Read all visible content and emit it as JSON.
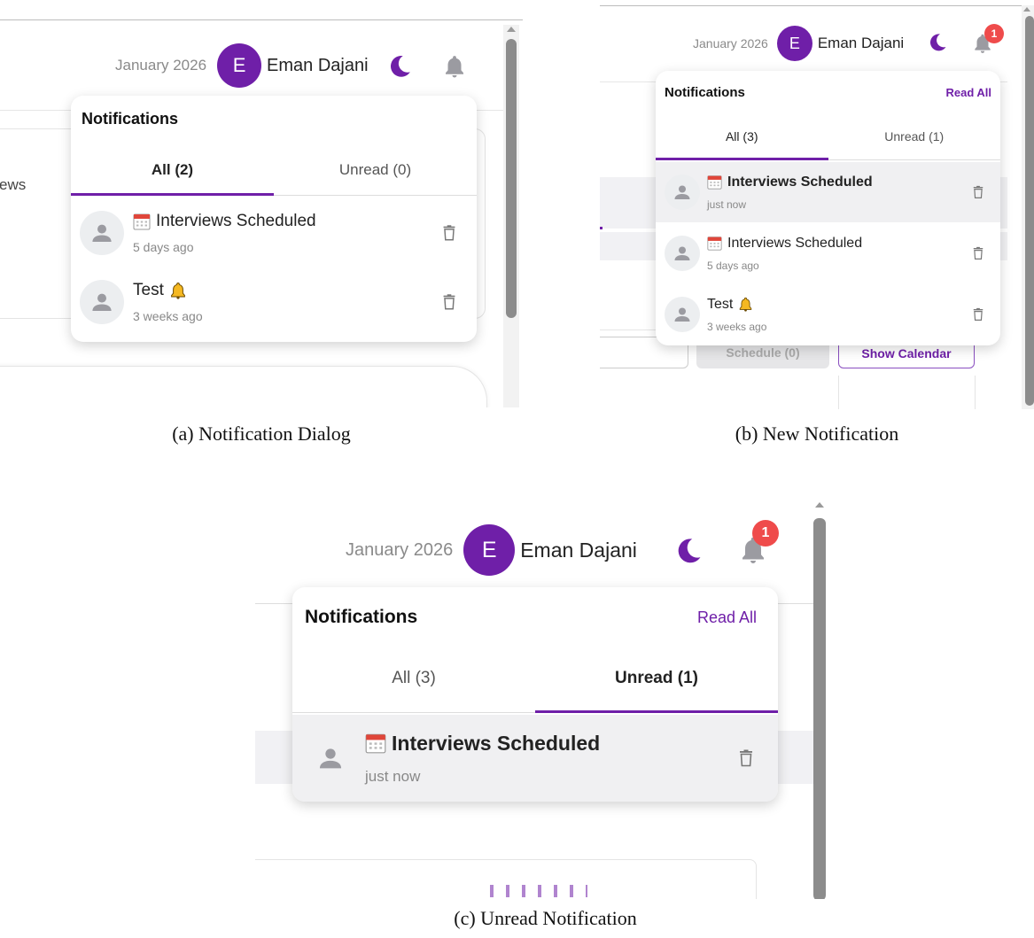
{
  "header": {
    "date": "January 2026",
    "avatar_initial": "E",
    "user_name": "Eman Dajani"
  },
  "colors": {
    "accent": "#6f1fa8",
    "badge": "#ef4b4b",
    "unread_row": "#f0f0f2"
  },
  "icons": {
    "theme": "moon-icon",
    "bell": "bell-icon",
    "person": "person-icon",
    "calendar": "calendar-emoji-icon",
    "bell_emoji": "bell-emoji-icon",
    "delete": "trash-icon"
  },
  "panel_a": {
    "caption": "(a) Notification Dialog",
    "background_text": "ews",
    "notifications": {
      "title": "Notifications",
      "tabs": [
        {
          "label": "All (2)",
          "active": true
        },
        {
          "label": "Unread (0)",
          "active": false
        }
      ],
      "items": [
        {
          "title": "Interviews Scheduled",
          "time": "5 days ago",
          "icon": "calendar",
          "unread": false
        },
        {
          "title": "Test",
          "time": "3 weeks ago",
          "icon": "bell",
          "unread": false
        }
      ]
    }
  },
  "panel_b": {
    "caption": "(b) New Notification",
    "badge_count": "1",
    "notifications": {
      "title": "Notifications",
      "read_all": "Read All",
      "tabs": [
        {
          "label": "All (3)",
          "active": true
        },
        {
          "label": "Unread (1)",
          "active": false
        }
      ],
      "items": [
        {
          "title": "Interviews Scheduled",
          "time": "just now",
          "icon": "calendar",
          "unread": true
        },
        {
          "title": "Interviews Scheduled",
          "time": "5 days ago",
          "icon": "calendar",
          "unread": false
        },
        {
          "title": "Test",
          "time": "3 weeks ago",
          "icon": "bell",
          "unread": false
        }
      ]
    },
    "buttons": {
      "schedule": "Schedule (0)",
      "show_calendar": "Show Calendar"
    }
  },
  "panel_c": {
    "caption": "(c) Unread Notification",
    "badge_count": "1",
    "notifications": {
      "title": "Notifications",
      "read_all": "Read All",
      "tabs": [
        {
          "label": "All (3)",
          "active": false
        },
        {
          "label": "Unread (1)",
          "active": true
        }
      ],
      "items": [
        {
          "title": "Interviews Scheduled",
          "time": "just now",
          "icon": "calendar",
          "unread": true
        }
      ]
    }
  }
}
